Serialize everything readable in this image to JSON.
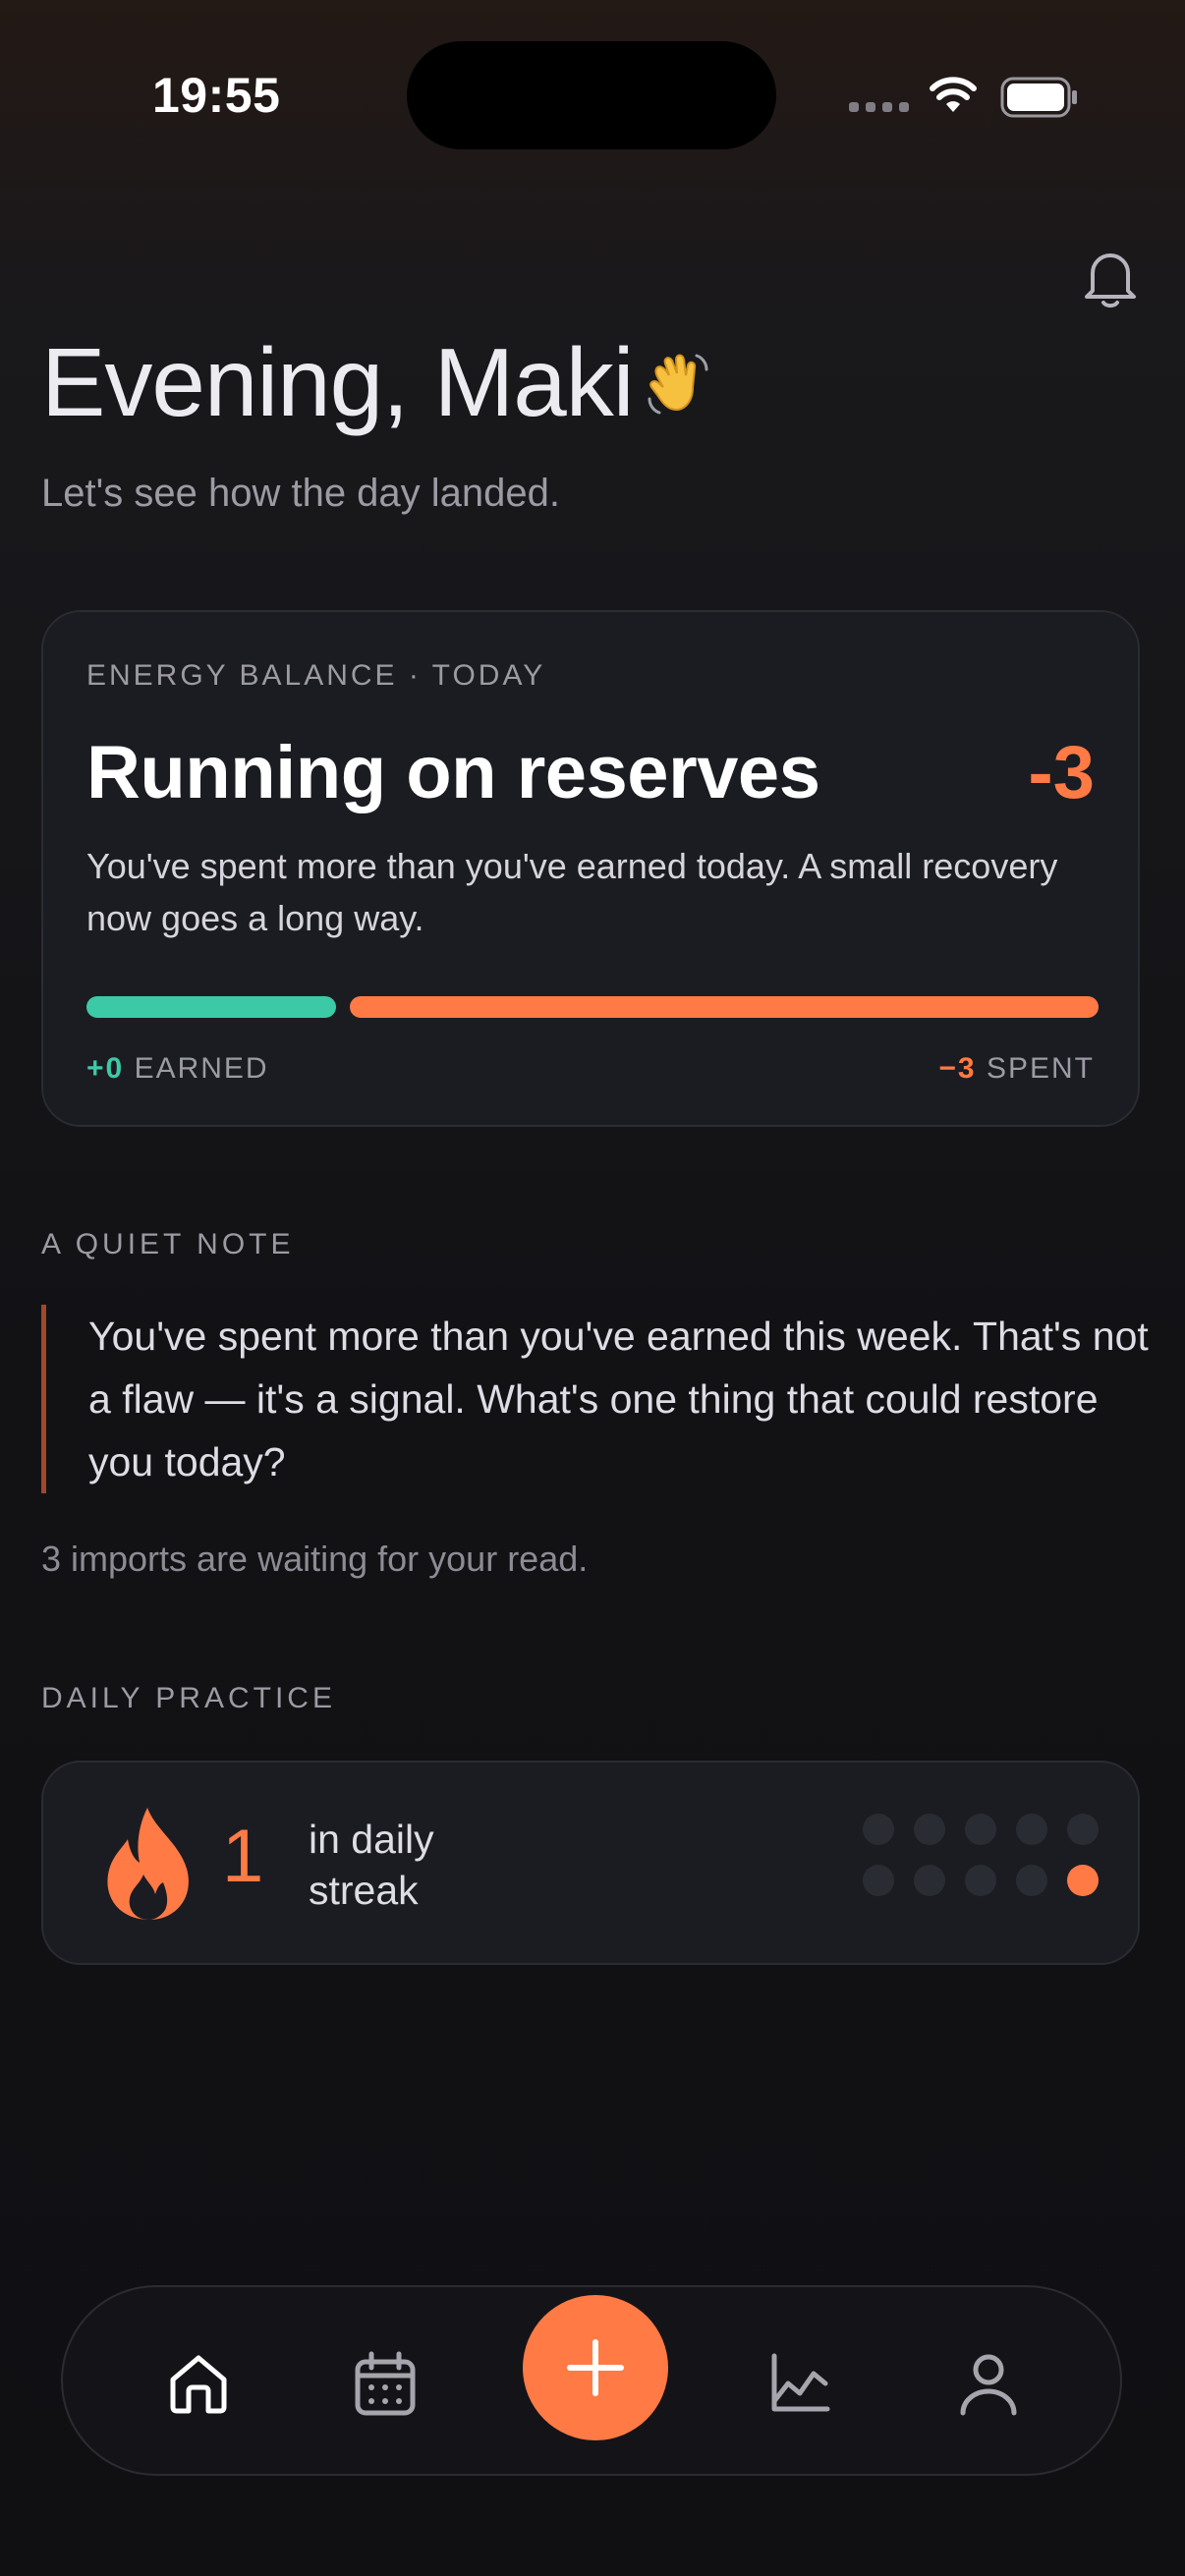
{
  "status_bar": {
    "time": "19:55"
  },
  "header": {
    "greeting": "Evening, Maki",
    "subtitle": "Let's see how the day landed."
  },
  "energy": {
    "eyebrow": "ENERGY BALANCE · TODAY",
    "title": "Running on reserves",
    "delta": "-3",
    "body": "You've spent more than you've earned today. A small recovery now goes a long way.",
    "earned_value": "+0",
    "earned_label": "EARNED",
    "spent_value": "−3",
    "spent_label": "SPENT"
  },
  "note": {
    "label": "A QUIET NOTE",
    "text": "You've spent more than you've earned this week. That's not a flaw — it's a signal. What's one thing that could restore you today?",
    "imports": "3 imports are waiting for your read."
  },
  "practice": {
    "label": "DAILY PRACTICE",
    "streak_count": "1",
    "streak_label": "in daily streak",
    "dots": [
      false,
      false,
      false,
      false,
      false,
      false,
      false,
      false,
      false,
      true
    ]
  },
  "colors": {
    "accent": "#ff7a45",
    "earned": "#3ccaa6",
    "card": "#1b1c22"
  },
  "nav": {
    "items": [
      "home-icon",
      "calendar-icon",
      "add-icon",
      "chart-icon",
      "profile-icon"
    ],
    "active": "home-icon"
  }
}
